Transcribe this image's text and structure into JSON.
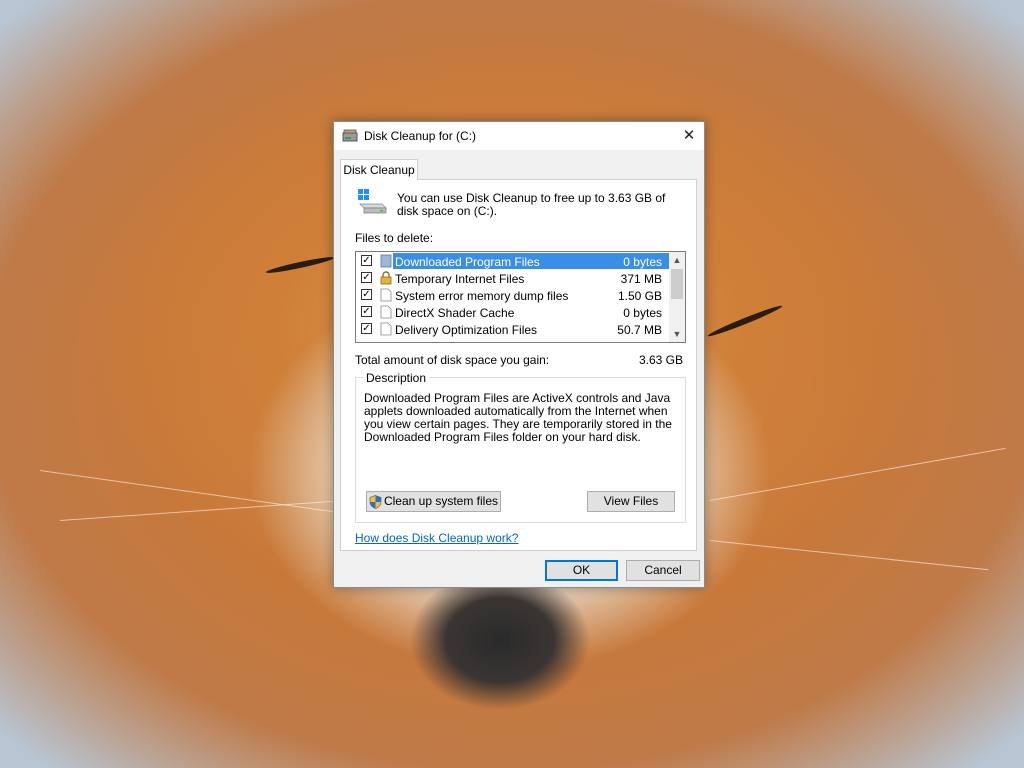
{
  "window": {
    "title": "Disk Cleanup for  (C:)",
    "close_glyph": "✕"
  },
  "tab": {
    "label": "Disk Cleanup"
  },
  "intro": "You can use Disk Cleanup to free up to 3.63 GB of disk space on  (C:).",
  "files_to_delete_label": "Files to delete:",
  "files": [
    {
      "checked": true,
      "name": "Downloaded Program Files",
      "size": "0 bytes",
      "icon": "folder-icon",
      "selected": true
    },
    {
      "checked": true,
      "name": "Temporary Internet Files",
      "size": "371 MB",
      "icon": "lock-icon",
      "selected": false
    },
    {
      "checked": true,
      "name": "System error memory dump files",
      "size": "1.50 GB",
      "icon": "file-icon",
      "selected": false
    },
    {
      "checked": true,
      "name": "DirectX Shader Cache",
      "size": "0 bytes",
      "icon": "file-icon",
      "selected": false
    },
    {
      "checked": true,
      "name": "Delivery Optimization Files",
      "size": "50.7 MB",
      "icon": "file-icon",
      "selected": false
    }
  ],
  "check_glyph": "✓",
  "scroll": {
    "up": "▲",
    "down": "▼"
  },
  "total": {
    "label": "Total amount of disk space you gain:",
    "value": "3.63 GB"
  },
  "description": {
    "legend": "Description",
    "text": "Downloaded Program Files are ActiveX controls and Java applets downloaded automatically from the Internet when you view certain pages. They are temporarily stored in the Downloaded Program Files folder on your hard disk."
  },
  "buttons": {
    "cleanup_system": "Clean up system files",
    "view_files": "View Files",
    "ok": "OK",
    "cancel": "Cancel"
  },
  "help_link": "How does Disk Cleanup work?",
  "colors": {
    "selection": "#3a8ee6",
    "link": "#0066cc",
    "default_button_border": "#0078d7"
  }
}
